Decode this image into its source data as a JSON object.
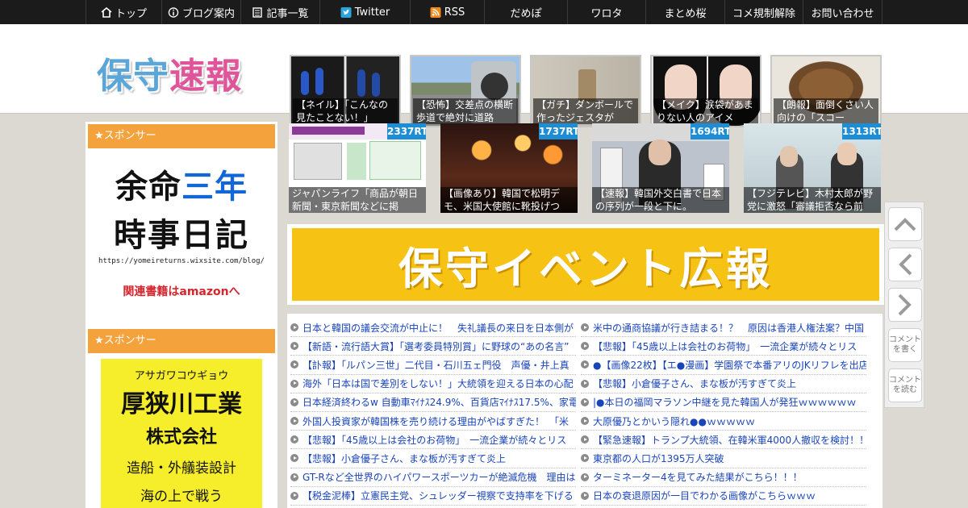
{
  "nav": {
    "items": [
      {
        "label": "トップ",
        "icon": "home-icon"
      },
      {
        "label": "ブログ案内",
        "icon": "info-icon"
      },
      {
        "label": "記事一覧",
        "icon": "list-icon"
      },
      {
        "label": "Twitter",
        "icon": "twitter-icon"
      },
      {
        "label": "RSS",
        "icon": "rss-icon"
      },
      {
        "label": "だめぽ",
        "icon": ""
      },
      {
        "label": "ワロタ",
        "icon": ""
      },
      {
        "label": "まとめ桜",
        "icon": ""
      },
      {
        "label": "コメ規制解除",
        "icon": ""
      },
      {
        "label": "お問い合わせ",
        "icon": ""
      }
    ]
  },
  "header": {
    "logo_part1": "保守",
    "logo_part2": "速報",
    "thumbs": [
      {
        "caption": "【ネイル】「こんなの見たことない！」"
      },
      {
        "caption": "【恐怖】交差点の横断歩道で絶対に道路"
      },
      {
        "caption": "【ガチ】ダンボールで作ったジェスタが"
      },
      {
        "caption": "【メイク】涙袋があまりない人のアイメ"
      },
      {
        "caption": "【朗報】面倒くさい人向けの「スコー"
      }
    ]
  },
  "sidebar": {
    "sponsor_label_1": "★スポンサー",
    "sponsor_label_2": "★スポンサー",
    "banner1": {
      "line1_a": "余命",
      "line1_b": "三年",
      "line2": "時事日記",
      "url": "https://yomeireturns.wixsite.com/blog/",
      "link": "関連書籍はamazonへ"
    },
    "banner2": {
      "kana": "アサガワコウギョウ",
      "name": "厚狭川工業",
      "corp": "株式会社",
      "desc": "造船・外艤装設計",
      "more": "海の上で戦う"
    }
  },
  "rt_cards": [
    {
      "badge": "2337RT",
      "caption": "ジャパンライフ「商品が朝日新聞・東京新聞などに掲"
    },
    {
      "badge": "1737RT",
      "caption": "【画像あり】韓国で松明デモ、米国大使館に靴投げつ"
    },
    {
      "badge": "1694RT",
      "caption": "【速報】韓国外交白書で日本の序列が一段と下に。"
    },
    {
      "badge": "1313RT",
      "caption": "【フジテレビ】木村太郎が野党に激怒「審議拒否なら前"
    }
  ],
  "event_banner": "保守イベント広報",
  "news": {
    "left": [
      "日本と韓国の議会交流が中止に！　失礼議長の来日を日本側が",
      "【新語・流行語大賞】「選考委員特別賞」に野球の“あの名言”",
      "【訃報】「ルパン三世」二代目・石川五ェ門役　声優・井上真",
      "海外「日本は国で差別をしない！」大統領を迎える日本の心配",
      "日本経済終わるw 自動車ﾏｲﾅｽ24.9%、百貨店ﾏｲﾅｽ17.5%、家電ﾏ",
      "外国人投資家が韓国株を売り続ける理由がやばすぎた！　「米",
      "【悲報】「45歳以上は会社のお荷物」　一流企業が続々とリス",
      "【悲報】小倉優子さん、まな板が汚すぎて炎上",
      "GT-Rなど全世界のハイパワースポーツカーが絶滅危機　理由は",
      "【税金泥棒】立憲民主党、シュレッダー視察で支持率を下げる"
    ],
    "right": [
      "米中の通商協議が行き詰まる！？　原因は香港人権法案？中国",
      "【悲報】「45歳以上は会社のお荷物」　一流企業が続々とリス",
      "●【画像22枚】【エ●漫画】学園祭で本番アリのJKリフレを出店",
      "【悲報】小倉優子さん、まな板が汚すぎて炎上",
      "|●本日の福岡マラソン中継を見た韓国人が発狂ｗｗｗｗｗｗ",
      "大原優乃とかいう隠れ●●ｗｗｗｗｗ",
      "【緊急速報】トランプ大統領、在韓米軍4000人撤収を検討！！",
      "東京都の人口が1395万人突破",
      "ターミネーター4を見てみた結果がこちら！！！",
      "日本の衰退原因が一目でわかる画像がこちらｗｗｗ"
    ]
  },
  "side_buttons": {
    "write_comment": "コメントを書く",
    "read_comment": "コメントを読む"
  },
  "colors": {
    "nav_bg": "#1b1b1b",
    "sponsor_orange": "#f3a23c",
    "rt_badge": "#1d8ed6",
    "event_yellow": "#f6c213",
    "link_blue": "#1a45b8"
  }
}
